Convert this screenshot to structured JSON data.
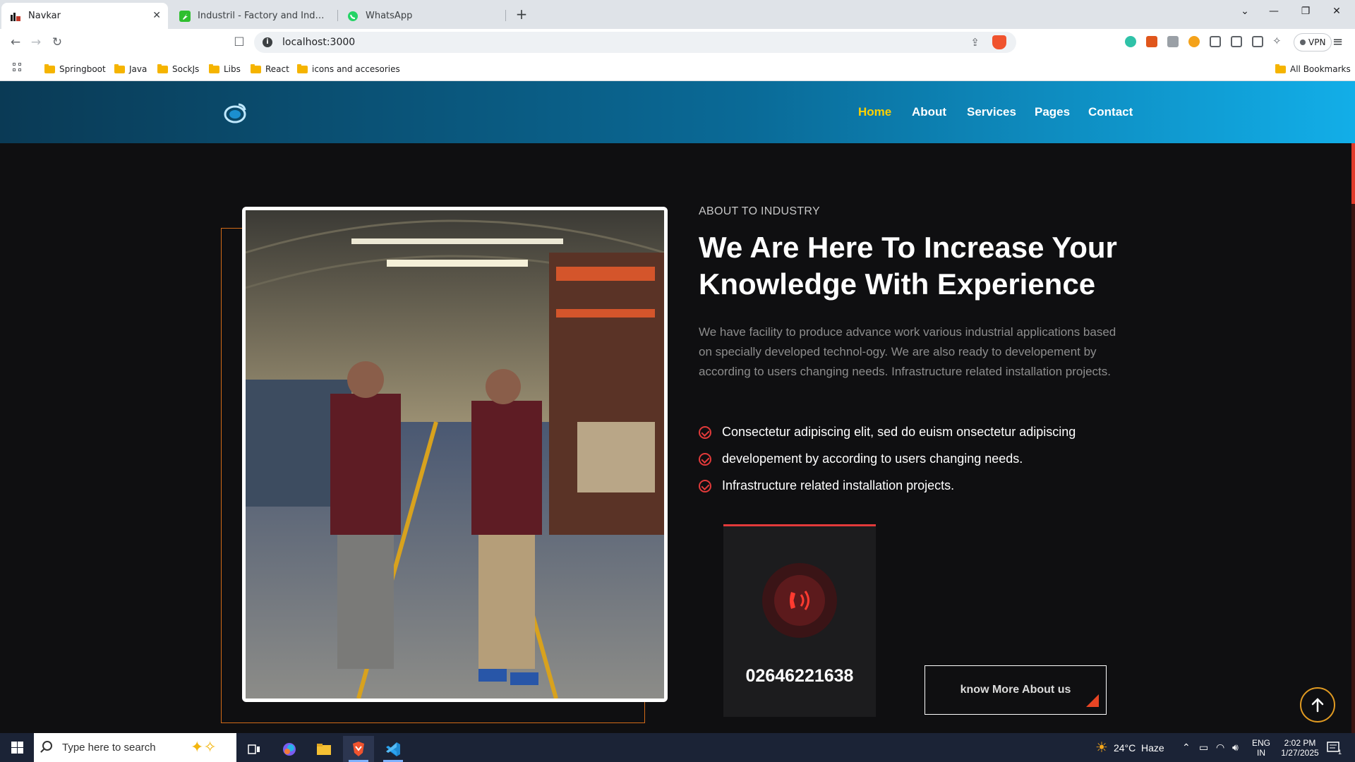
{
  "browser": {
    "tabs": [
      {
        "title": "Navkar",
        "active": true
      },
      {
        "title": "Industril - Factory and Industrial Re",
        "active": false
      },
      {
        "title": "WhatsApp",
        "active": false
      }
    ],
    "url": "localhost:3000",
    "vpn_label": "VPN",
    "bookmarks": [
      "Springboot",
      "Java",
      "SockJs",
      "Libs",
      "React",
      "icons and accesories"
    ],
    "all_bookmarks": "All Bookmarks"
  },
  "site": {
    "nav": [
      {
        "label": "Home",
        "active": true
      },
      {
        "label": "About",
        "active": false
      },
      {
        "label": "Services",
        "active": false
      },
      {
        "label": "Pages",
        "active": false
      },
      {
        "label": "Contact",
        "active": false
      }
    ],
    "about": {
      "kicker": "ABOUT TO INDUSTRY",
      "heading": "We Are Here To Increase Your Knowledge With Experience",
      "paragraph": "We have facility to produce advance work various industrial applications based on specially developed technol-ogy. We are also ready to developement by according to users changing needs. Infrastructure related installation projects.",
      "checklist": [
        "Consectetur adipiscing elit, sed do euism onsectetur adipiscing",
        "developement by according to users changing needs.",
        "Infrastructure related installation projects."
      ],
      "phone": "02646221638",
      "cta_label": "know More About us"
    },
    "colors": {
      "accent_red": "#e23a3a",
      "nav_active": "#ffd000",
      "outline_orange": "#d26b18"
    }
  },
  "taskbar": {
    "search_placeholder": "Type here to search",
    "weather": "24°C  Haze",
    "language": "ENG",
    "region": "IN",
    "time": "2:02 PM",
    "date": "1/27/2025",
    "notification_count": "1"
  }
}
